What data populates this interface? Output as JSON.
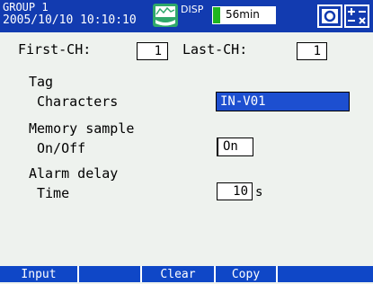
{
  "header": {
    "group": "GROUP 1",
    "datetime": "2005/10/10 10:10:10",
    "disp_label": "DISP",
    "timer_text": "56min",
    "icons": [
      "display-memory-icon",
      "record-icon",
      "math-icon"
    ],
    "colors": {
      "bar": "#123bb0",
      "timer_fill": "#1fb61f"
    }
  },
  "channel": {
    "first_label": "First-CH:",
    "first_value": "1",
    "last_label": "Last-CH:",
    "last_value": "1"
  },
  "tag": {
    "section_label": "Tag",
    "characters_label": "Characters",
    "characters_value": "IN-V01"
  },
  "memory": {
    "section_label": "Memory sample",
    "onoff_label": "On/Off",
    "onoff_value": "On"
  },
  "alarm": {
    "section_label": "Alarm delay",
    "time_label": "Time",
    "time_value": "10",
    "time_unit": "s"
  },
  "softkeys": [
    "Input",
    "",
    "Clear",
    "Copy"
  ],
  "colors": {
    "selection": "#1d4fd0",
    "softkey_bar": "#0f47c7",
    "background": "#eef2ee"
  }
}
